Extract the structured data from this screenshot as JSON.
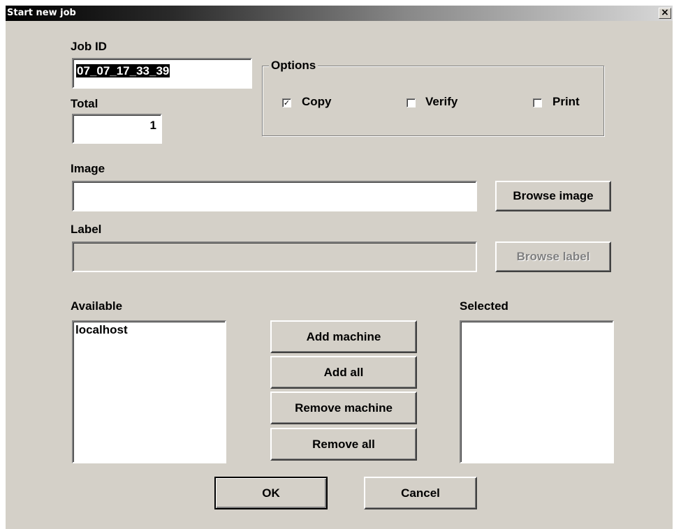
{
  "window": {
    "title": "Start new job",
    "close": "×"
  },
  "job_id": {
    "label": "Job ID",
    "value": "07_07_17_33_39"
  },
  "total": {
    "label": "Total",
    "value": "1"
  },
  "options": {
    "label": "Options",
    "copy": {
      "label": "Copy",
      "checked": true,
      "mark": "✓"
    },
    "verify": {
      "label": "Verify",
      "checked": false
    },
    "print": {
      "label": "Print",
      "checked": false
    }
  },
  "image": {
    "label": "Image",
    "value": "",
    "browse": "Browse image"
  },
  "label_field": {
    "label": "Label",
    "value": "",
    "browse": "Browse label"
  },
  "available": {
    "label": "Available",
    "items": [
      "localhost"
    ]
  },
  "selected": {
    "label": "Selected",
    "items": []
  },
  "buttons": {
    "add_machine": "Add machine",
    "add_all": "Add all",
    "remove_machine": "Remove machine",
    "remove_all": "Remove all",
    "ok": "OK",
    "cancel": "Cancel"
  }
}
